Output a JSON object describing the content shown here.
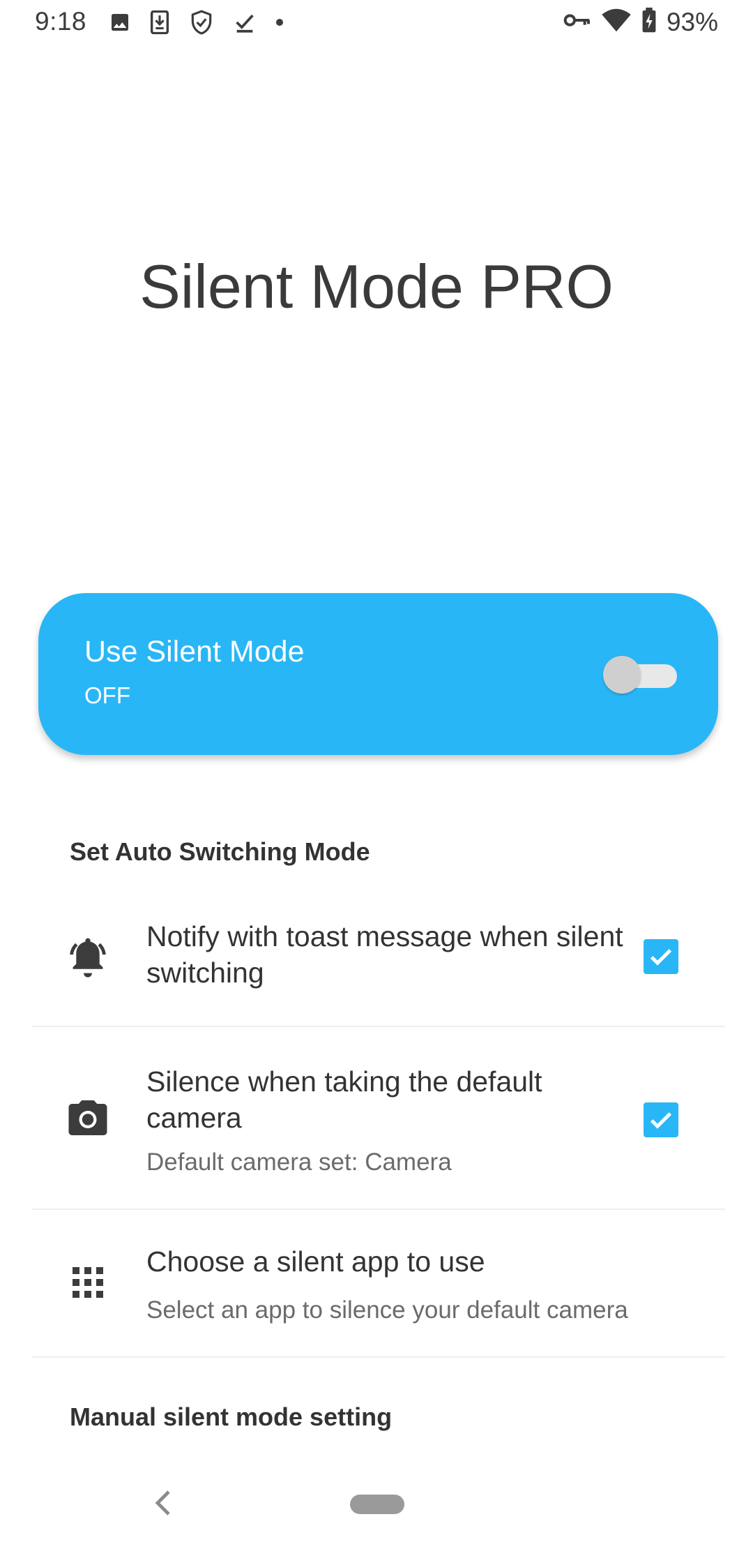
{
  "status_bar": {
    "time": "9:18",
    "left_icons": [
      "image-icon",
      "download-status-icon",
      "shield-check-icon",
      "download-done-icon",
      "dot-icon"
    ],
    "right_icons": [
      "vpn-key-icon",
      "wifi-icon",
      "battery-charging-icon"
    ],
    "battery_percent": "93%"
  },
  "app": {
    "title": "Silent Mode PRO"
  },
  "silent_card": {
    "title": "Use Silent Mode",
    "state_text": "OFF",
    "toggle_on": false,
    "background_color": "#29b6f6"
  },
  "sections": {
    "auto_switching_header": "Set Auto Switching Mode",
    "manual_header": "Manual silent mode setting"
  },
  "settings": [
    {
      "icon": "bell-icon",
      "title": "Notify with toast message when silent switching",
      "summary": "",
      "checked": true
    },
    {
      "icon": "camera-icon",
      "title": "Silence when taking the default camera",
      "summary": "Default camera set: Camera",
      "checked": true
    },
    {
      "icon": "apps-grid-icon",
      "title": "Choose a silent app to use",
      "summary": "Select an app to silence your default camera",
      "checked": null
    }
  ],
  "nav_bar": {
    "icons": [
      "back-icon",
      "home-pill-icon"
    ]
  },
  "colors": {
    "accent": "#29b6f6",
    "text_primary": "#333333",
    "text_secondary": "#6b6b6b"
  }
}
